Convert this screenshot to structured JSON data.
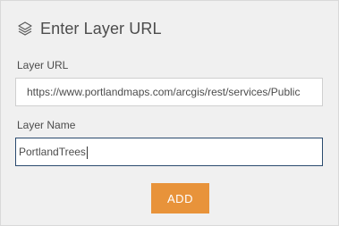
{
  "header": {
    "icon": "layers-icon",
    "title": "Enter Layer URL"
  },
  "layer_url": {
    "label": "Layer URL",
    "value": "https://www.portlandmaps.com/arcgis/rest/services/Publiс"
  },
  "layer_name": {
    "label": "Layer Name",
    "value": "PortlandTrees"
  },
  "add_button": {
    "label": "ADD"
  },
  "colors": {
    "panel_background": "#f0f0f0",
    "button_accent": "#e8933a",
    "focus_border": "#2a4a6e"
  }
}
